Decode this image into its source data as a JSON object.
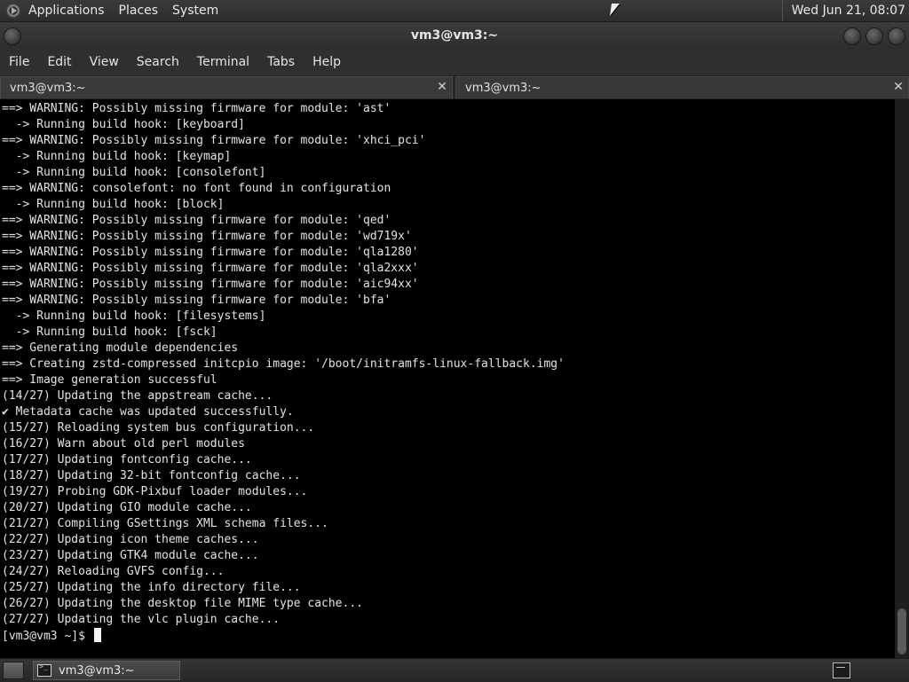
{
  "top_panel": {
    "menus": [
      "Applications",
      "Places",
      "System"
    ],
    "clock": "Wed Jun 21, 08:07"
  },
  "window": {
    "title": "vm3@vm3:~"
  },
  "menubar": {
    "items": [
      "File",
      "Edit",
      "View",
      "Search",
      "Terminal",
      "Tabs",
      "Help"
    ]
  },
  "tabs": [
    {
      "label": "vm3@vm3:~",
      "active": true
    },
    {
      "label": "vm3@vm3:~",
      "active": false
    }
  ],
  "terminal": {
    "lines": [
      "==> WARNING: Possibly missing firmware for module: 'ast'",
      "  -> Running build hook: [keyboard]",
      "==> WARNING: Possibly missing firmware for module: 'xhci_pci'",
      "  -> Running build hook: [keymap]",
      "  -> Running build hook: [consolefont]",
      "==> WARNING: consolefont: no font found in configuration",
      "  -> Running build hook: [block]",
      "==> WARNING: Possibly missing firmware for module: 'qed'",
      "==> WARNING: Possibly missing firmware for module: 'wd719x'",
      "==> WARNING: Possibly missing firmware for module: 'qla1280'",
      "==> WARNING: Possibly missing firmware for module: 'qla2xxx'",
      "==> WARNING: Possibly missing firmware for module: 'aic94xx'",
      "==> WARNING: Possibly missing firmware for module: 'bfa'",
      "  -> Running build hook: [filesystems]",
      "  -> Running build hook: [fsck]",
      "==> Generating module dependencies",
      "==> Creating zstd-compressed initcpio image: '/boot/initramfs-linux-fallback.img'",
      "==> Image generation successful",
      "(14/27) Updating the appstream cache...",
      "✔ Metadata cache was updated successfully.",
      "(15/27) Reloading system bus configuration...",
      "(16/27) Warn about old perl modules",
      "(17/27) Updating fontconfig cache...",
      "(18/27) Updating 32-bit fontconfig cache...",
      "(19/27) Probing GDK-Pixbuf loader modules...",
      "(20/27) Updating GIO module cache...",
      "(21/27) Compiling GSettings XML schema files...",
      "(22/27) Updating icon theme caches...",
      "(23/27) Updating GTK4 module cache...",
      "(24/27) Reloading GVFS config...",
      "(25/27) Updating the info directory file...",
      "(26/27) Updating the desktop file MIME type cache...",
      "(27/27) Updating the vlc plugin cache..."
    ],
    "prompt": "[vm3@vm3 ~]$ "
  },
  "taskbar": {
    "task_label": "vm3@vm3:~"
  },
  "icons": {
    "close": "✕"
  },
  "colors": {
    "terminal_bg": "#000000",
    "terminal_fg": "#e3e3e3",
    "chrome_bg": "#2f2f2f"
  }
}
